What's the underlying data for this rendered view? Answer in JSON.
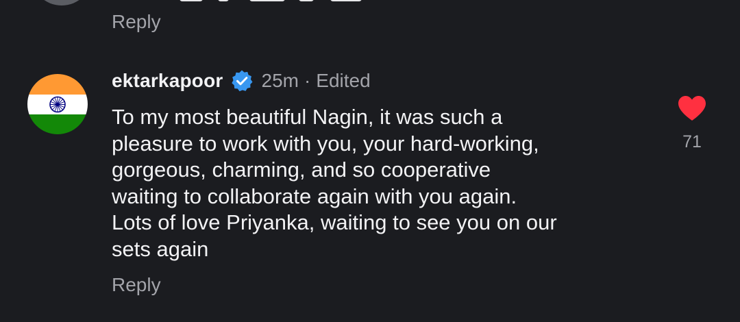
{
  "previous_comment": {
    "reply_label": "Reply"
  },
  "comment": {
    "username": "ektarkapoor",
    "verified_icon": "verified-badge-icon",
    "time": "25m",
    "separator": "·",
    "edited_label": "Edited",
    "text_lines": [
      "To my most beautiful Nagin, it was such a",
      "pleasure to work with you, your hard-working,",
      "gorgeous, charming, and so cooperative",
      "waiting to collaborate again with you again.",
      "Lots of love Priyanka, waiting to see you on our",
      "sets again"
    ],
    "reply_label": "Reply",
    "like_icon": "heart-icon",
    "like_count": "71",
    "avatar_icon": "india-flag-avatar"
  },
  "colors": {
    "background": "#1b1c20",
    "primary_text": "#f2f2f4",
    "secondary_text": "#a3a4aa",
    "verified_blue": "#3897f0",
    "heart_red": "#ff3040",
    "flag_saffron": "#ff9933",
    "flag_white": "#ffffff",
    "flag_green": "#138808",
    "flag_chakra": "#000080"
  }
}
